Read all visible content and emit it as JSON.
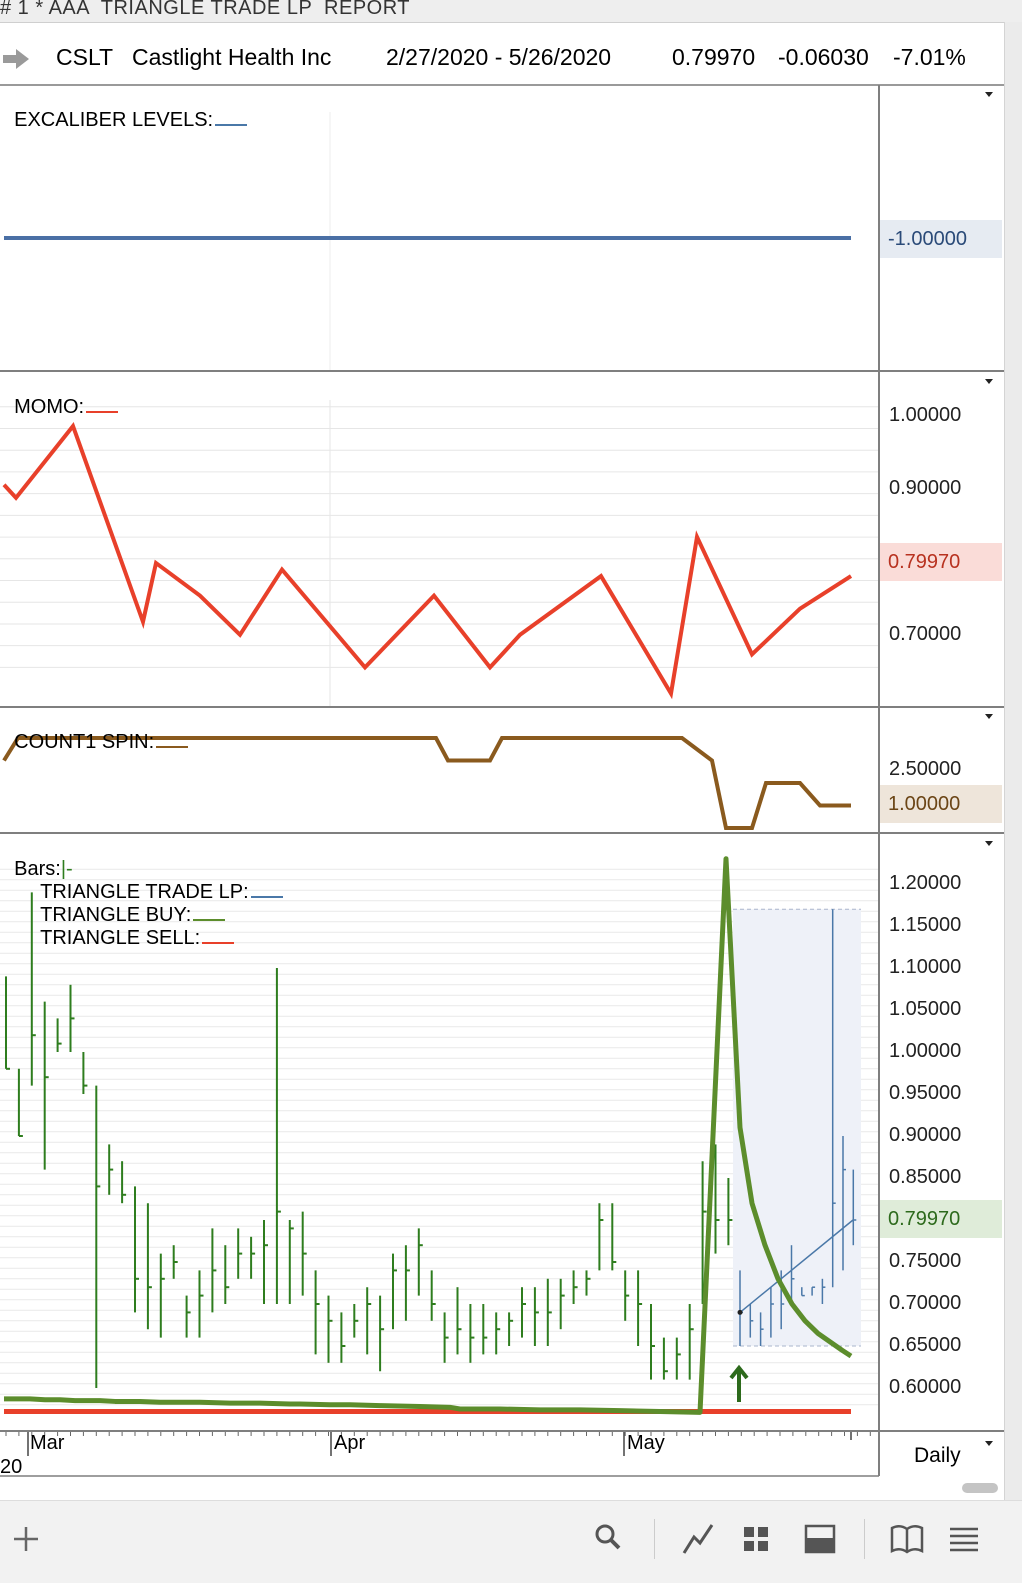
{
  "window": {
    "title": "# 1 * AAA  TRIANGLE TRADE LP  REPORT"
  },
  "header": {
    "symbol": "CSLT",
    "company": "Castlight Health Inc",
    "date_range": "2/27/2020 - 5/26/2020",
    "last": "0.79970",
    "change": "-0.06030",
    "pct_change": "-7.01%"
  },
  "panels": {
    "excaliber": {
      "label": "EXCALIBER LEVELS:",
      "axis_value": "-1.00000",
      "color": "#4a6fa5"
    },
    "momo": {
      "label": "MOMO:",
      "ticks": [
        "1.00000",
        "0.90000",
        "0.70000"
      ],
      "current": "0.79970",
      "color": "#e8402a"
    },
    "count": {
      "label": "COUNT1 SPIN:",
      "ticks": [
        "2.50000"
      ],
      "current": "1.00000",
      "color": "#8a5a1e"
    },
    "price": {
      "labels": {
        "bars": "Bars:",
        "bars_sym": "|-",
        "tlp": "TRIANGLE TRADE LP:",
        "buy": "TRIANGLE BUY:",
        "sell": "TRIANGLE SELL:"
      },
      "ticks": [
        "1.20000",
        "1.15000",
        "1.10000",
        "1.05000",
        "1.00000",
        "0.95000",
        "0.90000",
        "0.85000",
        "0.75000",
        "0.70000",
        "0.65000",
        "0.60000"
      ],
      "current": "0.79970"
    }
  },
  "axis": {
    "months": [
      "Mar",
      "Apr",
      "May"
    ],
    "year_fragment": "20",
    "interval": "Daily"
  },
  "colors": {
    "bars": "#2e7d1e",
    "buy": "#5c8d2c",
    "sell": "#e8402a",
    "tlp": "#4a78a8",
    "momo": "#e8402a",
    "count": "#8a5a1e",
    "level": "#4a6fa5"
  },
  "chart_data": [
    {
      "type": "line",
      "title": "EXCALIBER LEVELS",
      "series": [
        {
          "values": [
            -1.0,
            -1.0
          ]
        }
      ],
      "x": [
        "2/27/2020",
        "5/26/2020"
      ]
    },
    {
      "type": "line",
      "title": "MOMO",
      "ylim": [
        0.6,
        1.06
      ],
      "series": [
        {
          "values": [
            0.93,
            0.91,
            1.02,
            0.72,
            0.81,
            0.76,
            0.7,
            0.8,
            0.65,
            0.76,
            0.65,
            0.7,
            0.79,
            0.61,
            0.85,
            0.67,
            0.74,
            0.79
          ]
        }
      ]
    },
    {
      "type": "line",
      "title": "COUNT1 SPIN",
      "series": [
        {
          "values": [
            3.0,
            4.0,
            4.0,
            4.0,
            3.0,
            3.0,
            4.0,
            4.0,
            4.0,
            3.0,
            0.0,
            0.0,
            2.0,
            2.0,
            1.0,
            1.0
          ]
        }
      ]
    },
    {
      "type": "ohlc",
      "title": "Bars",
      "ylim": [
        0.565,
        1.24
      ],
      "bars": [
        {
          "h": 1.09,
          "l": 0.98,
          "c": 0.98
        },
        {
          "h": 0.98,
          "l": 0.9,
          "c": 0.9
        },
        {
          "h": 1.19,
          "l": 0.96,
          "c": 1.02
        },
        {
          "h": 1.06,
          "l": 0.86,
          "c": 0.97
        },
        {
          "h": 1.04,
          "l": 1.0,
          "c": 1.01
        },
        {
          "h": 1.08,
          "l": 1.0,
          "c": 1.04
        },
        {
          "h": 1.0,
          "l": 0.95,
          "c": 0.96
        },
        {
          "h": 0.96,
          "l": 0.6,
          "c": 0.84
        },
        {
          "h": 0.89,
          "l": 0.83,
          "c": 0.86
        },
        {
          "h": 0.87,
          "l": 0.82,
          "c": 0.83
        },
        {
          "h": 0.84,
          "l": 0.69,
          "c": 0.73
        },
        {
          "h": 0.82,
          "l": 0.67,
          "c": 0.72
        },
        {
          "h": 0.76,
          "l": 0.66,
          "c": 0.73
        },
        {
          "h": 0.77,
          "l": 0.73,
          "c": 0.75
        },
        {
          "h": 0.71,
          "l": 0.66,
          "c": 0.69
        },
        {
          "h": 0.74,
          "l": 0.66,
          "c": 0.71
        },
        {
          "h": 0.79,
          "l": 0.69,
          "c": 0.74
        },
        {
          "h": 0.77,
          "l": 0.7,
          "c": 0.72
        },
        {
          "h": 0.79,
          "l": 0.73,
          "c": 0.76
        },
        {
          "h": 0.78,
          "l": 0.73,
          "c": 0.76
        },
        {
          "h": 0.8,
          "l": 0.7,
          "c": 0.77
        },
        {
          "h": 1.1,
          "l": 0.7,
          "c": 0.81
        },
        {
          "h": 0.8,
          "l": 0.7,
          "c": 0.79
        },
        {
          "h": 0.81,
          "l": 0.71,
          "c": 0.76
        },
        {
          "h": 0.74,
          "l": 0.64,
          "c": 0.7
        },
        {
          "h": 0.71,
          "l": 0.63,
          "c": 0.68
        },
        {
          "h": 0.69,
          "l": 0.63,
          "c": 0.65
        },
        {
          "h": 0.7,
          "l": 0.66,
          "c": 0.68
        },
        {
          "h": 0.72,
          "l": 0.64,
          "c": 0.7
        },
        {
          "h": 0.71,
          "l": 0.62,
          "c": 0.67
        },
        {
          "h": 0.76,
          "l": 0.67,
          "c": 0.74
        },
        {
          "h": 0.77,
          "l": 0.68,
          "c": 0.74
        },
        {
          "h": 0.79,
          "l": 0.71,
          "c": 0.77
        },
        {
          "h": 0.74,
          "l": 0.68,
          "c": 0.7
        },
        {
          "h": 0.69,
          "l": 0.63,
          "c": 0.66
        },
        {
          "h": 0.72,
          "l": 0.64,
          "c": 0.67
        },
        {
          "h": 0.7,
          "l": 0.63,
          "c": 0.66
        },
        {
          "h": 0.7,
          "l": 0.64,
          "c": 0.66
        },
        {
          "h": 0.69,
          "l": 0.64,
          "c": 0.67
        },
        {
          "h": 0.69,
          "l": 0.65,
          "c": 0.68
        },
        {
          "h": 0.72,
          "l": 0.66,
          "c": 0.7
        },
        {
          "h": 0.72,
          "l": 0.65,
          "c": 0.69
        },
        {
          "h": 0.73,
          "l": 0.65,
          "c": 0.69
        },
        {
          "h": 0.73,
          "l": 0.67,
          "c": 0.71
        },
        {
          "h": 0.74,
          "l": 0.7,
          "c": 0.72
        },
        {
          "h": 0.74,
          "l": 0.71,
          "c": 0.73
        },
        {
          "h": 0.82,
          "l": 0.74,
          "c": 0.8
        },
        {
          "h": 0.82,
          "l": 0.74,
          "c": 0.75
        },
        {
          "h": 0.74,
          "l": 0.68,
          "c": 0.71
        },
        {
          "h": 0.74,
          "l": 0.65,
          "c": 0.7
        },
        {
          "h": 0.7,
          "l": 0.61,
          "c": 0.65
        },
        {
          "h": 0.66,
          "l": 0.61,
          "c": 0.62
        },
        {
          "h": 0.66,
          "l": 0.61,
          "c": 0.64
        },
        {
          "h": 0.7,
          "l": 0.61,
          "c": 0.67
        },
        {
          "h": 0.87,
          "l": 0.7,
          "c": 0.81
        },
        {
          "h": 0.89,
          "l": 0.76,
          "c": 0.8
        },
        {
          "h": 0.85,
          "l": 0.77,
          "c": 0.8
        }
      ],
      "tlp_bars": [
        {
          "h": 0.74,
          "l": 0.65,
          "c": 0.69
        },
        {
          "h": 0.7,
          "l": 0.66,
          "c": 0.68
        },
        {
          "h": 0.69,
          "l": 0.65,
          "c": 0.67
        },
        {
          "h": 0.72,
          "l": 0.66,
          "c": 0.7
        },
        {
          "h": 0.74,
          "l": 0.67,
          "c": 0.7
        },
        {
          "h": 0.77,
          "l": 0.7,
          "c": 0.73
        },
        {
          "h": 0.72,
          "l": 0.71,
          "c": 0.71
        },
        {
          "h": 0.72,
          "l": 0.71,
          "c": 0.72
        },
        {
          "h": 0.73,
          "l": 0.7,
          "c": 0.72
        },
        {
          "h": 1.17,
          "l": 0.72,
          "c": 0.82
        },
        {
          "h": 0.9,
          "l": 0.74,
          "c": 0.86
        },
        {
          "h": 0.86,
          "l": 0.77,
          "c": 0.8
        }
      ],
      "buy_line": [
        0.587,
        0.587,
        0.586,
        0.586,
        0.585,
        0.585,
        0.584,
        0.584,
        0.583,
        0.583,
        0.583,
        0.582,
        0.582,
        0.581,
        0.581,
        0.58,
        0.58,
        0.579,
        0.578,
        0.577,
        0.575,
        0.575,
        0.574,
        0.574,
        0.573,
        0.572,
        0.571,
        1.23,
        0.91,
        0.82,
        0.77,
        0.73,
        0.7,
        0.68,
        0.665,
        0.655,
        0.645,
        0.638
      ],
      "sell_line": [
        0.572,
        0.572
      ],
      "tlp_line": [
        0.69,
        0.8
      ]
    }
  ]
}
